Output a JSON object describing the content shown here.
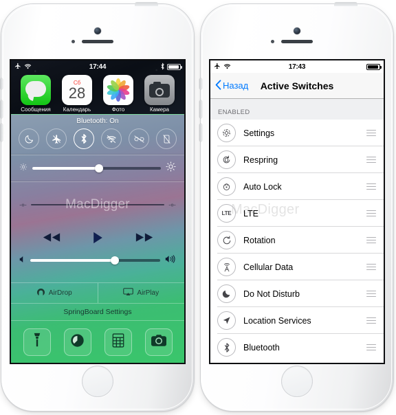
{
  "left_phone": {
    "status_bar": {
      "time": "17:44",
      "airplane_icon": "airplane-icon",
      "wifi_icon": "wifi-icon",
      "bluetooth_icon": "bluetooth-icon",
      "battery_icon": "battery-icon"
    },
    "apps": [
      {
        "label": "Сообщения",
        "icon": "messages-icon"
      },
      {
        "label": "Календарь",
        "icon": "calendar-icon",
        "day_of_week": "Сб",
        "day_number": "28"
      },
      {
        "label": "Фото",
        "icon": "photos-icon"
      },
      {
        "label": "Камера",
        "icon": "camera-icon"
      }
    ],
    "control_center": {
      "bluetooth_status": "Bluetooth: On",
      "toggles": [
        {
          "name": "do-not-disturb-toggle",
          "icon": "moon-icon",
          "active": false
        },
        {
          "name": "airplane-mode-toggle",
          "icon": "airplane-slashed-icon",
          "active": false
        },
        {
          "name": "bluetooth-toggle",
          "icon": "bluetooth-icon",
          "active": true
        },
        {
          "name": "wifi-toggle",
          "icon": "wifi-slashed-icon",
          "active": false
        },
        {
          "name": "cellular-toggle",
          "icon": "link-slashed-icon",
          "active": false
        },
        {
          "name": "rotation-lock-toggle",
          "icon": "rotation-lock-slashed-icon",
          "active": false
        }
      ],
      "brightness": {
        "value": 52,
        "low_icon": "brightness-low-icon",
        "high_icon": "brightness-high-icon"
      },
      "now_playing": {
        "watermark": "MacDigger",
        "airplay_progress": 0
      },
      "transport": [
        {
          "name": "previous-track-button",
          "icon": "rewind-icon"
        },
        {
          "name": "play-button",
          "icon": "play-icon"
        },
        {
          "name": "next-track-button",
          "icon": "fast-forward-icon"
        }
      ],
      "volume": {
        "value": 65,
        "low_icon": "volume-low-icon",
        "high_icon": "volume-high-icon"
      },
      "airdrop_label": "AirDrop",
      "airplay_label": "AirPlay",
      "springboard_label": "SpringBoard Settings",
      "shortcuts": [
        {
          "name": "flashlight-shortcut",
          "icon": "flashlight-icon"
        },
        {
          "name": "timer-shortcut",
          "icon": "timer-icon"
        },
        {
          "name": "calculator-shortcut",
          "icon": "calculator-icon"
        },
        {
          "name": "camera-shortcut",
          "icon": "camera-icon"
        }
      ]
    }
  },
  "right_phone": {
    "status_bar": {
      "time": "17:43",
      "airplane_icon": "airplane-icon",
      "wifi_icon": "wifi-icon",
      "battery_icon": "battery-icon"
    },
    "navbar": {
      "back_label": "Назад",
      "back_icon": "chevron-left-icon",
      "title": "Active Switches"
    },
    "section_header": "ENABLED",
    "watermark": "MacDigger",
    "rows": [
      {
        "label": "Settings",
        "icon": "settings-gear-icon",
        "handle": "reorder-handle"
      },
      {
        "label": "Respring",
        "icon": "respring-icon",
        "handle": "reorder-handle"
      },
      {
        "label": "Auto Lock",
        "icon": "auto-lock-icon",
        "handle": "reorder-handle"
      },
      {
        "label": "LTE",
        "icon": "lte-icon",
        "handle": "reorder-handle"
      },
      {
        "label": "Rotation",
        "icon": "rotation-icon",
        "handle": "reorder-handle"
      },
      {
        "label": "Cellular Data",
        "icon": "cellular-tower-icon",
        "handle": "reorder-handle"
      },
      {
        "label": "Do Not Disturb",
        "icon": "moon-icon",
        "handle": "reorder-handle"
      },
      {
        "label": "Location Services",
        "icon": "location-arrow-icon",
        "handle": "reorder-handle"
      },
      {
        "label": "Bluetooth",
        "icon": "bluetooth-icon",
        "handle": "reorder-handle"
      }
    ]
  },
  "colors": {
    "accent_blue": "#007aff",
    "nav_bg": "#f7f7f7",
    "section_bg": "#eff0f2",
    "separator": "#d8d8da",
    "cc_green": "#3ecd6e"
  }
}
